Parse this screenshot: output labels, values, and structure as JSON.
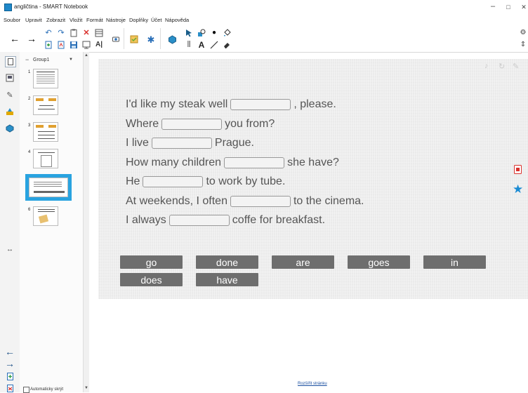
{
  "window": {
    "title": "angličtina - SMART Notebook",
    "minimize": "–",
    "maximize": "□",
    "close": "✕"
  },
  "menu": [
    "Soubor",
    "Upravit",
    "Zobrazit",
    "Vložit",
    "Formát",
    "Nástroje",
    "Doplňky",
    "Účet",
    "Nápověda"
  ],
  "sorter": {
    "group_label": "Group1",
    "collapse_symbol": "−",
    "dropdown_symbol": "▼",
    "page_numbers": [
      "1",
      "2",
      "3",
      "4",
      "5",
      "6"
    ],
    "auto_hide_label": "Automaticky skrýt"
  },
  "exercise": {
    "sentences": [
      {
        "before": "I'd like my steak well",
        "after": ", please."
      },
      {
        "before": "Where",
        "after": "you from?"
      },
      {
        "before": "I live",
        "after": "Prague."
      },
      {
        "before": "How many children",
        "after": "she have?"
      },
      {
        "before": "He",
        "after": "to work by tube."
      },
      {
        "before": "At weekends, I often",
        "after": "to the cinema."
      },
      {
        "before": "I always",
        "after": "coffe for breakfast."
      }
    ],
    "words": [
      "go",
      "done",
      "are",
      "goes",
      "in",
      "does",
      "have"
    ]
  },
  "footer": {
    "extend_page": "Rozšířit stránku"
  },
  "colors": {
    "word_tile": "#6e6e6e",
    "selected_thumb": "#29a3e0",
    "sentence_text": "#555555"
  }
}
